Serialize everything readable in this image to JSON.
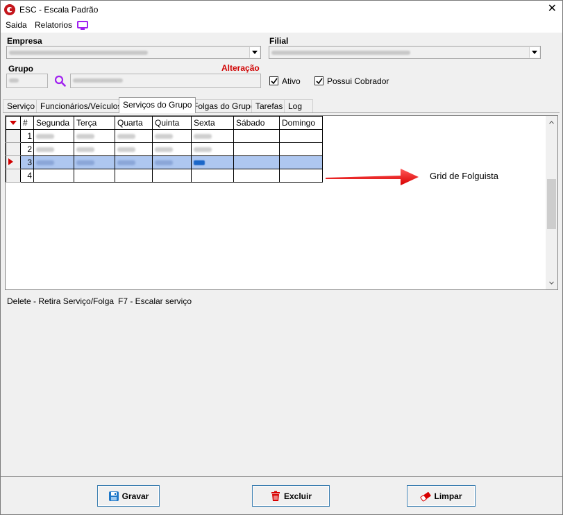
{
  "window": {
    "title": "ESC - Escala Padrão",
    "close_glyph": "✕"
  },
  "menu": {
    "items": [
      "Saida",
      "Relatorios"
    ],
    "monitor_icon_color": "#a020f0"
  },
  "form": {
    "empresa_label": "Empresa",
    "filial_label": "Filial",
    "grupo_label": "Grupo",
    "status_label": "Alteração",
    "ativo_label": "Ativo",
    "ativo_checked": true,
    "possui_cobrador_label": "Possui Cobrador",
    "possui_cobrador_checked": true
  },
  "tabs": [
    "Serviço",
    "Funcionários/Veículos",
    "Serviços do Grupo",
    "Folgas do Grupo",
    "Tarefas",
    "Log"
  ],
  "active_tab": "Serviços do Grupo",
  "grid": {
    "columns": [
      "#",
      "Segunda",
      "Terça",
      "Quarta",
      "Quinta",
      "Sexta",
      "Sábado",
      "Domingo"
    ],
    "rows": [
      {
        "num": "1",
        "selected": false
      },
      {
        "num": "2",
        "selected": false
      },
      {
        "num": "3",
        "selected": true
      },
      {
        "num": "4",
        "selected": false
      }
    ]
  },
  "annotation": {
    "text": "Grid de Folguista",
    "arrow_color": "#ff0000"
  },
  "hints": {
    "delete": "Delete - Retira Serviço/Folga",
    "f7": "F7 - Escalar serviço"
  },
  "buttons": {
    "gravar": "Gravar",
    "excluir": "Excluir",
    "limpar": "Limpar"
  },
  "colors": {
    "accent_red": "#d00000",
    "selection": "#aec7f0",
    "button_border": "#3c7fb1"
  }
}
